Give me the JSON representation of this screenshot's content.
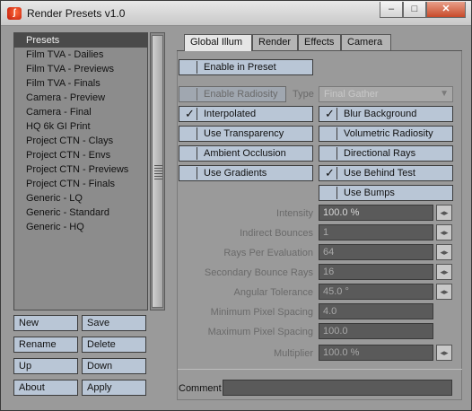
{
  "window": {
    "title": "Render Presets v1.0",
    "app_icon": "lightwave-logo-icon",
    "controls": {
      "minimize": "–",
      "maximize": "□",
      "close": "✕"
    }
  },
  "presets": {
    "items": [
      "Presets",
      "Film TVA - Dailies",
      "Film TVA - Previews",
      "Film TVA - Finals",
      "Camera - Preview",
      "Camera - Final",
      "HQ 6k GI Print",
      "Project CTN - Clays",
      "Project CTN - Envs",
      "Project CTN - Previews",
      "Project CTN - Finals",
      "Generic - LQ",
      "Generic - Standard",
      "Generic - HQ"
    ],
    "selected_index": 0
  },
  "buttons": {
    "new": "New",
    "save": "Save",
    "rename": "Rename",
    "delete": "Delete",
    "up": "Up",
    "down": "Down",
    "about": "About",
    "apply": "Apply"
  },
  "tabs": [
    "Global Illum",
    "Render",
    "Effects",
    "Camera"
  ],
  "active_tab": "Global Illum",
  "global_illum": {
    "enable_in_preset": {
      "label": "Enable in Preset",
      "checked": false
    },
    "enable_radiosity": {
      "label": "Enable Radiosity",
      "checked": false
    },
    "type": {
      "label": "Type",
      "value": "Final Gather"
    },
    "checkboxes": {
      "interpolated": {
        "label": "Interpolated",
        "checked": true
      },
      "blur_background": {
        "label": "Blur Background",
        "checked": true
      },
      "use_transparency": {
        "label": "Use Transparency",
        "checked": false
      },
      "volumetric_radiosity": {
        "label": "Volumetric Radiosity",
        "checked": false
      },
      "ambient_occlusion": {
        "label": "Ambient Occlusion",
        "checked": false
      },
      "directional_rays": {
        "label": "Directional Rays",
        "checked": false
      },
      "use_gradients": {
        "label": "Use Gradients",
        "checked": false
      },
      "use_behind_test": {
        "label": "Use Behind Test",
        "checked": true
      },
      "use_bumps": {
        "label": "Use Bumps",
        "checked": false
      }
    },
    "fields": {
      "intensity": {
        "label": "Intensity",
        "value": "100.0 %"
      },
      "indirect_bounces": {
        "label": "Indirect Bounces",
        "value": "1"
      },
      "rays_per_evaluation": {
        "label": "Rays Per Evaluation",
        "value": "64"
      },
      "secondary_bounce_rays": {
        "label": "Secondary Bounce Rays",
        "value": "16"
      },
      "angular_tolerance": {
        "label": "Angular Tolerance",
        "value": "45.0 °"
      },
      "min_pixel_spacing": {
        "label": "Minimum Pixel Spacing",
        "value": "4.0"
      },
      "max_pixel_spacing": {
        "label": "Maximum Pixel Spacing",
        "value": "100.0"
      },
      "multiplier": {
        "label": "Multiplier",
        "value": "100.0 %"
      }
    },
    "spinner_icon": "◂▸"
  },
  "comment": {
    "label": "Comment",
    "value": ""
  }
}
